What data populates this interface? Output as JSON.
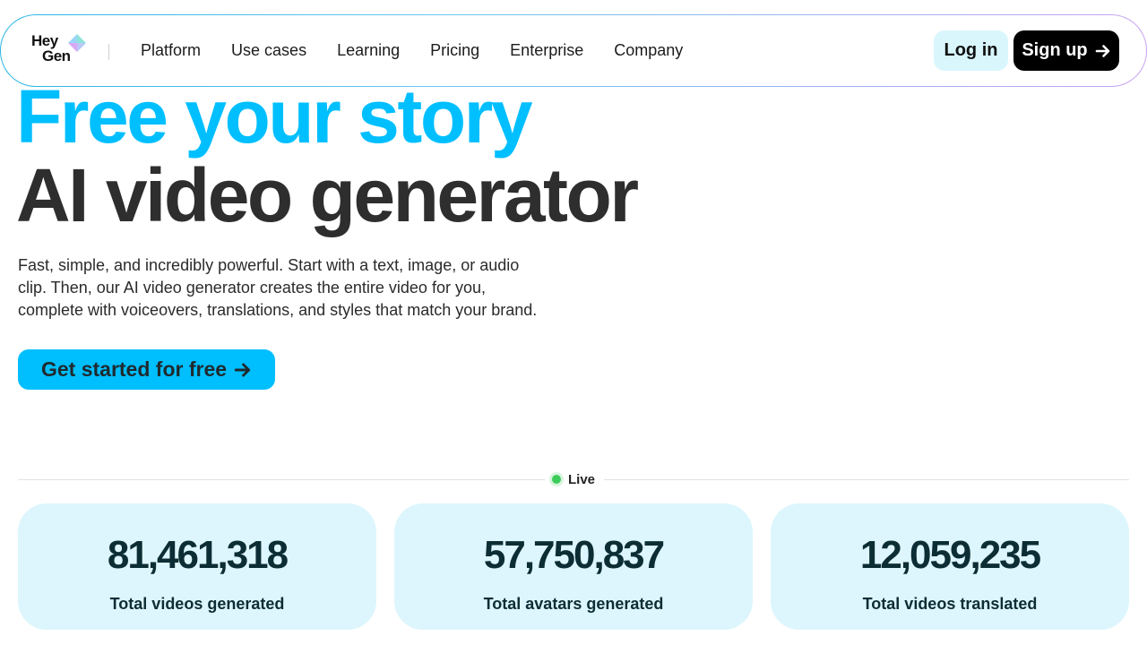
{
  "brand": {
    "logo_line1": "Hey",
    "logo_line2": "Gen",
    "accent": "#00bfff"
  },
  "nav": {
    "items": [
      {
        "label": "Platform"
      },
      {
        "label": "Use cases"
      },
      {
        "label": "Learning"
      },
      {
        "label": "Pricing"
      },
      {
        "label": "Enterprise"
      },
      {
        "label": "Company"
      }
    ],
    "login_label": "Log in",
    "signup_label": "Sign up"
  },
  "hero": {
    "headline_accent": "Free your story",
    "headline_main": "AI video generator",
    "description": "Fast, simple, and incredibly powerful. Start with a text, image, or audio clip. Then, our AI video generator creates the entire video for you, complete with voiceovers, translations, and styles that match your brand.",
    "cta_label": "Get started for free"
  },
  "live": {
    "label": "Live",
    "dot_color": "#3dcc5a"
  },
  "stats": [
    {
      "value": "81,461,318",
      "label": "Total videos generated"
    },
    {
      "value": "57,750,837",
      "label": "Total avatars generated"
    },
    {
      "value": "12,059,235",
      "label": "Total videos translated"
    }
  ]
}
